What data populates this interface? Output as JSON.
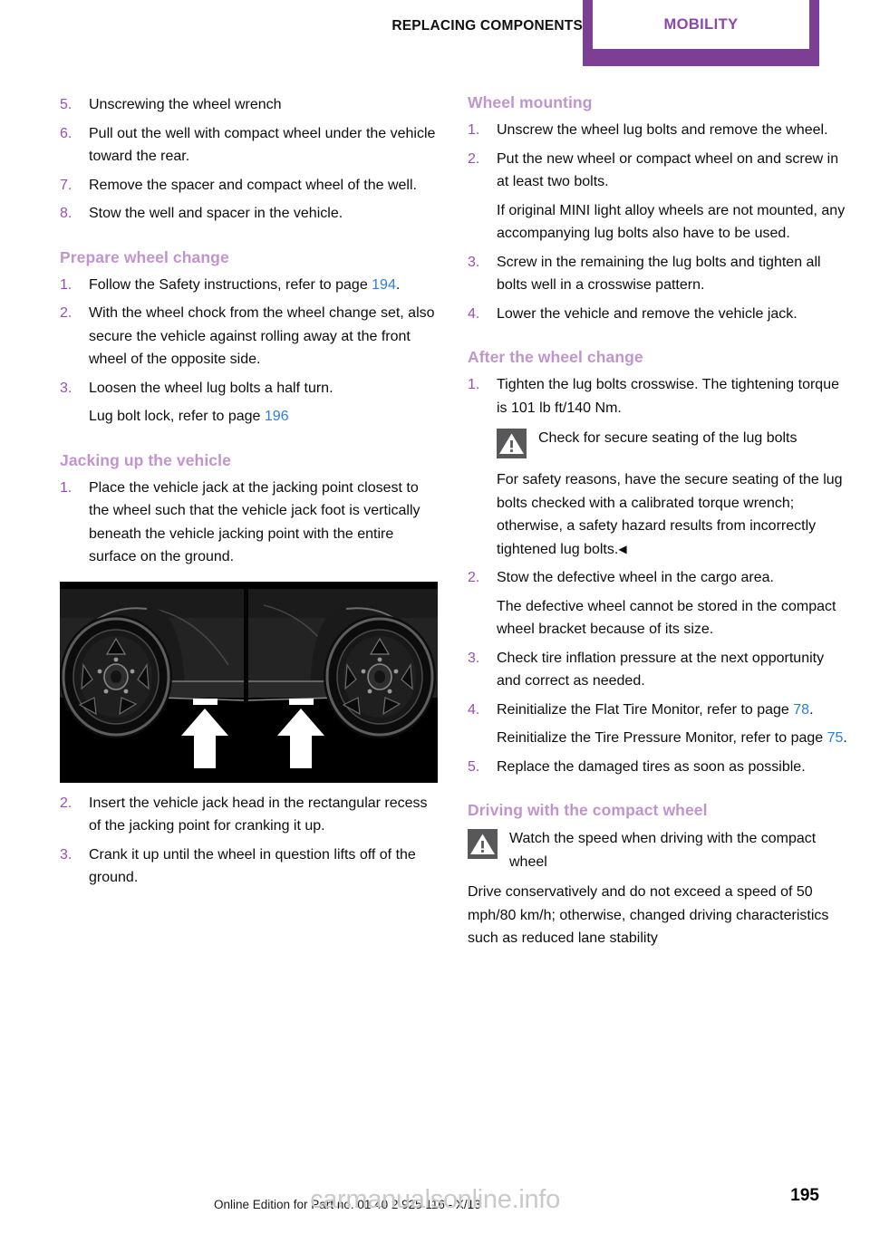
{
  "header": {
    "chapter_label": "REPLACING COMPONENTS",
    "tab_label": "MOBILITY",
    "tab_color": "#7d3f94",
    "tab_text_color": "#8e44ad"
  },
  "colors": {
    "heading": "#c194cd",
    "list_number": "#9b4fb5",
    "page_reference": "#2a7de1",
    "warning_icon_bg": "#58585a",
    "body_text": "#0d0d0d"
  },
  "left_column": {
    "continued_steps": [
      {
        "num": "5.",
        "text": "Unscrewing the wheel wrench"
      },
      {
        "num": "6.",
        "text": "Pull out the well with compact wheel under the vehicle toward the rear."
      },
      {
        "num": "7.",
        "text": "Remove the spacer and compact wheel of the well."
      },
      {
        "num": "8.",
        "text": "Stow the well and spacer in the vehicle."
      }
    ],
    "prepare_section": {
      "heading": "Prepare wheel change",
      "step1_num": "1.",
      "step1_text_before": "Follow the Safety instructions, refer to page ",
      "step1_pageref": "194",
      "step1_text_after": ".",
      "step2_num": "2.",
      "step2_text": "With the wheel chock from the wheel change set, also secure the vehicle against rolling away at the front wheel of the opposite side.",
      "step3_num": "3.",
      "step3_text": "Loosen the wheel lug bolts a half turn.",
      "step3_note_before": "Lug bolt lock, refer to page ",
      "step3_note_pageref": "196"
    },
    "jacking_section": {
      "heading": "Jacking up the vehicle",
      "step1_num": "1.",
      "step1_text": "Place the vehicle jack at the jacking point closest to the wheel such that the vehicle jack foot is vertically beneath the vehicle jacking point with the entire surface on the ground.",
      "figure_caption": "vehicle-side-view-jacking-points",
      "step2_num": "2.",
      "step2_text": "Insert the vehicle jack head in the rectangular recess of the jacking point for cranking it up.",
      "step3_num": "3.",
      "step3_text": "Crank it up until the wheel in question lifts off of the ground."
    }
  },
  "right_column": {
    "mounting_section": {
      "heading": "Wheel mounting",
      "step1_num": "1.",
      "step1_text": "Unscrew the wheel lug bolts and remove the wheel.",
      "step2_num": "2.",
      "step2_text": "Put the new wheel or compact wheel on and screw in at least two bolts.",
      "step2_note": "If original MINI light alloy wheels are not mounted, any accompanying lug bolts also have to be used.",
      "step3_num": "3.",
      "step3_text": "Screw in the remaining the lug bolts and tighten all bolts well in a crosswise pattern.",
      "step4_num": "4.",
      "step4_text": "Lower the vehicle and remove the vehicle jack."
    },
    "after_section": {
      "heading": "After the wheel change",
      "step1_num": "1.",
      "step1_text": "Tighten the lug bolts crosswise. The tightening torque is 101 lb ft/140 Nm.",
      "warning_title": "Check for secure seating of the lug bolts",
      "warning_body": "For safety reasons, have the secure seating of the lug bolts checked with a calibrated torque wrench; otherwise, a safety hazard results from incorrectly tightened lug bolts.",
      "warning_endmark": "◀",
      "step2_num": "2.",
      "step2_text": "Stow the defective wheel in the cargo area.",
      "step2_note": "The defective wheel cannot be stored in the compact wheel bracket because of its size.",
      "step3_num": "3.",
      "step3_text": "Check tire inflation pressure at the next opportunity and correct as needed.",
      "step4_num": "4.",
      "step4_text_before": "Reinitialize the Flat Tire Monitor, refer to page ",
      "step4_pageref": "78",
      "step4_text_after": ".",
      "step4_note_before": "Reinitialize the Tire Pressure Monitor, refer to page ",
      "step4_note_pageref": "75",
      "step4_note_after": ".",
      "step5_num": "5.",
      "step5_text": "Replace the damaged tires as soon as possible."
    },
    "driving_section": {
      "heading": "Driving with the compact wheel",
      "warning_title": "Watch the speed when driving with the compact wheel",
      "warning_body": "Drive conservatively and do not exceed a speed of 50 mph/80 km/h; otherwise, changed driving characteristics such as reduced lane stability"
    }
  },
  "footer": {
    "edition": "Online Edition for Part no. 01 40 2 925 116 - X/13",
    "page_number": "195",
    "watermark": "carmanualsonline.info"
  }
}
